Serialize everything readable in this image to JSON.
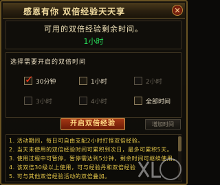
{
  "window": {
    "title": "感恩有你  双倍经验天天享",
    "close_icon": "close-icon"
  },
  "remaining": {
    "label": "可用的双倍经验剩余时间。",
    "value": "1小时"
  },
  "selection": {
    "label": "选择需要开启的双倍时间",
    "options": [
      {
        "label": "30分钟",
        "checked": true,
        "enabled": true
      },
      {
        "label": "1小时",
        "checked": false,
        "enabled": true
      },
      {
        "label": "2小时",
        "checked": false,
        "enabled": false
      },
      {
        "label": "3小时",
        "checked": false,
        "enabled": false
      },
      {
        "label": "4小时",
        "checked": false,
        "enabled": false
      },
      {
        "label": "全部时间",
        "checked": false,
        "enabled": true
      }
    ]
  },
  "buttons": {
    "start": "开启双倍经验",
    "add_time": "增加时间"
  },
  "notes": [
    "1. 活动期间，每日可自由支配2小时打怪双倍经验。",
    "2. 当天未使用的双倍经验时间可累积到次日，最多可累积5天。",
    "3. 使用过程中可暂停，暂停需达到5分钟，剩余时间可继续使用。",
    "4. 该双倍30级以上使用，可与经验丹和双倍经验",
    "5. 可与其他双倍经验活动的双倍叠加。"
  ],
  "colors": {
    "accent_gold": "#6a5424",
    "remaining_value": "#27e05a",
    "notes_text": "#e6c84a",
    "check_mark": "#ff3a1a"
  }
}
